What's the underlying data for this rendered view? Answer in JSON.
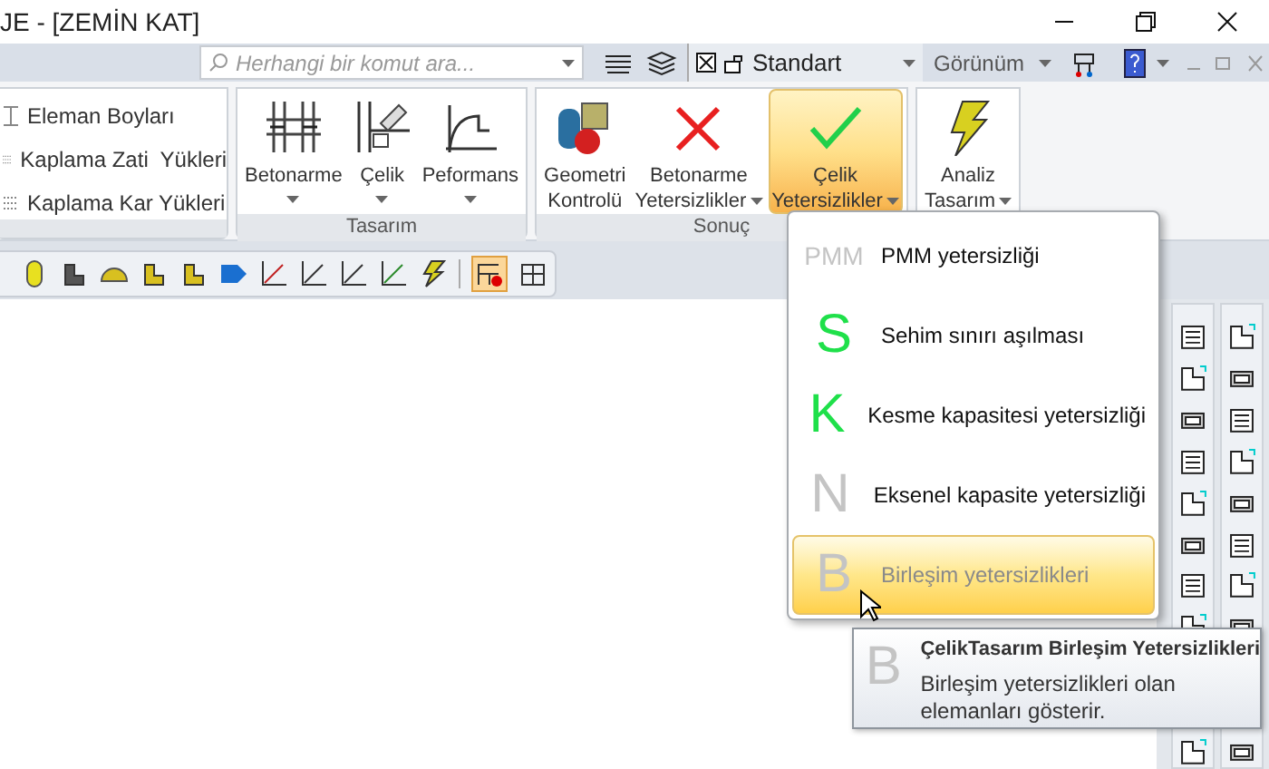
{
  "window": {
    "title": "JE - [ZEMİN KAT]"
  },
  "toolbar": {
    "search": {
      "placeholder": "Herhangi bir komut ara..."
    },
    "style_select": {
      "value": "Standart"
    },
    "view_menu": {
      "label": "Görünüm"
    }
  },
  "ribbon": {
    "side_items": [
      "Eleman Boyları",
      "Kaplama Zati  Yükleri",
      "Kaplama Kar Yükleri"
    ],
    "groups": [
      {
        "label": "Tasarım",
        "buttons": [
          {
            "lines": [
              "Betonarme"
            ],
            "dropdown": true,
            "selected": false
          },
          {
            "lines": [
              "Çelik"
            ],
            "dropdown": true,
            "selected": false
          },
          {
            "lines": [
              "Peformans"
            ],
            "dropdown": true,
            "selected": false
          }
        ]
      },
      {
        "label": "Sonuç",
        "buttons": [
          {
            "lines": [
              "Geometri",
              "Kontrolü"
            ],
            "dropdown": false,
            "selected": false
          },
          {
            "lines": [
              "Betonarme",
              "Yetersizlikler"
            ],
            "dropdown": true,
            "selected": false
          },
          {
            "lines": [
              "Çelik",
              "Yetersizlikler"
            ],
            "dropdown": true,
            "selected": true
          }
        ]
      },
      {
        "buttons": [
          {
            "lines": [
              "Analiz",
              "Tasarım"
            ],
            "dropdown": true,
            "selected": false
          }
        ]
      }
    ]
  },
  "menu": {
    "items": [
      {
        "icon_text": "PMM",
        "label": "PMM yetersizliği",
        "color": "#c4c4c4",
        "selected": false,
        "disabled": false
      },
      {
        "icon_text": "S",
        "label": "Sehim sınırı aşılması",
        "color": "#1fe04a",
        "selected": false,
        "disabled": false
      },
      {
        "icon_text": "K",
        "label": "Kesme kapasitesi yetersizliği",
        "color": "#1fe04a",
        "selected": false,
        "disabled": false
      },
      {
        "icon_text": "N",
        "label": "Eksenel kapasite yetersizliği",
        "color": "#c4c4c4",
        "selected": false,
        "disabled": false
      },
      {
        "icon_text": "B",
        "label": "Birleşim yetersizlikleri",
        "color": "#c4c4c4",
        "selected": true,
        "disabled": true
      }
    ]
  },
  "tooltip": {
    "icon_text": "B",
    "title": "ÇelikTasarım Birleşim Yetersizlikleri",
    "text": "Birleşim yetersizlikleri olan elemanları gösterir."
  }
}
